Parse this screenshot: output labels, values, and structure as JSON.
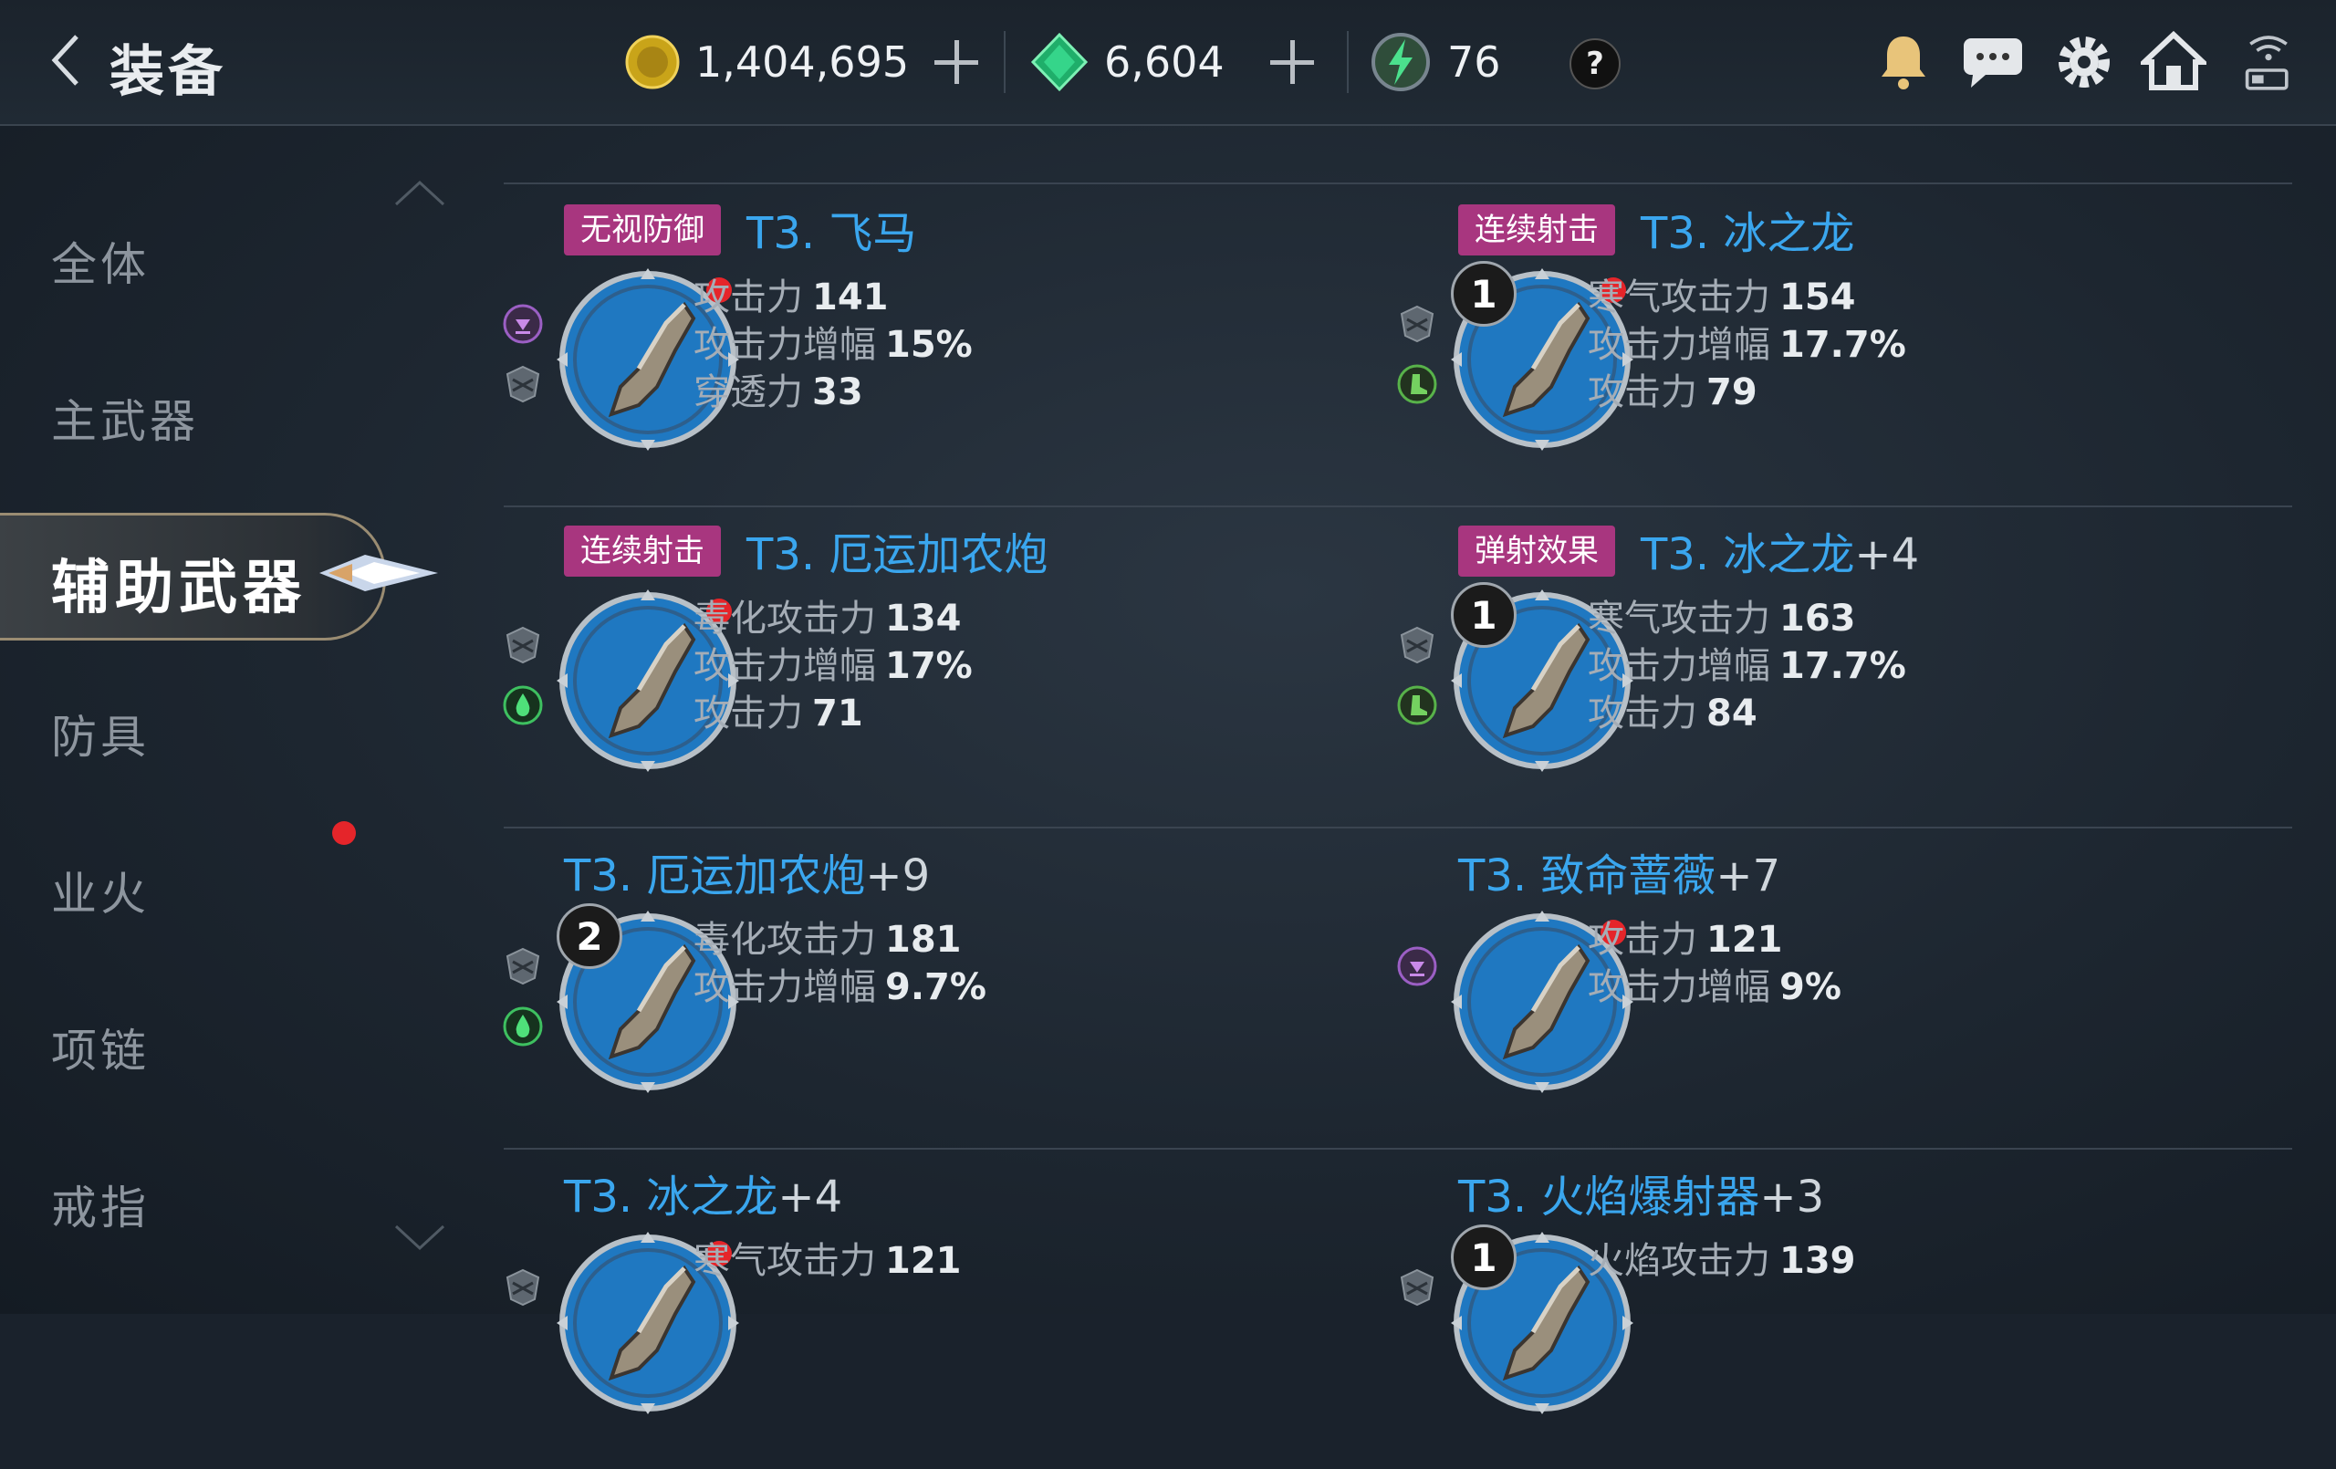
{
  "header": {
    "back_label": "back",
    "title": "装备",
    "gold": "1,404,695",
    "gems": "6,604",
    "energy": "76",
    "help": "?"
  },
  "sidebar": {
    "items": [
      {
        "label": "全体"
      },
      {
        "label": "主武器"
      },
      {
        "label": "辅助武器",
        "active": true
      },
      {
        "label": "防具"
      },
      {
        "label": "业火",
        "notify": true
      },
      {
        "label": "项链"
      },
      {
        "label": "戒指"
      }
    ]
  },
  "items": [
    {
      "tag": "无视防御",
      "name": "T3. 飞马",
      "level": "",
      "badge": "",
      "new": true,
      "stats": [
        {
          "label": "攻击力",
          "value": "141"
        },
        {
          "label": "攻击力增幅",
          "value": "15%"
        },
        {
          "label": "穿透力",
          "value": "33"
        }
      ],
      "icons": [
        "purple-down-icon",
        "shield-grey-icon"
      ],
      "accent": "#1f78c1"
    },
    {
      "tag": "连续射击",
      "name": "T3. 冰之龙",
      "level": "",
      "badge": "1",
      "new": true,
      "stats": [
        {
          "label": "寒气攻击力",
          "value": "154"
        },
        {
          "label": "攻击力增幅",
          "value": "17.7%"
        },
        {
          "label": "攻击力",
          "value": "79"
        }
      ],
      "icons": [
        "shield-grey-icon",
        "green-boot-icon"
      ],
      "accent": "#1f78c1"
    },
    {
      "tag": "连续射击",
      "name": "T3. 厄运加农炮",
      "level": "",
      "badge": "",
      "new": true,
      "stats": [
        {
          "label": "毒化攻击力",
          "value": "134"
        },
        {
          "label": "攻击力增幅",
          "value": "17%"
        },
        {
          "label": "攻击力",
          "value": "71"
        }
      ],
      "icons": [
        "shield-grey-icon",
        "green-drop-icon"
      ],
      "accent": "#1f78c1"
    },
    {
      "tag": "弹射效果",
      "name": "T3. 冰之龙",
      "level": "+4",
      "badge": "1",
      "new": false,
      "stats": [
        {
          "label": "寒气攻击力",
          "value": "163"
        },
        {
          "label": "攻击力增幅",
          "value": "17.7%"
        },
        {
          "label": "攻击力",
          "value": "84"
        }
      ],
      "icons": [
        "shield-grey-icon",
        "green-boot-icon"
      ],
      "accent": "#1f78c1"
    },
    {
      "tag": "",
      "name": "T3. 厄运加农炮",
      "level": "+9",
      "badge": "2",
      "new": false,
      "stats": [
        {
          "label": "毒化攻击力",
          "value": "181"
        },
        {
          "label": "攻击力增幅",
          "value": "9.7%"
        }
      ],
      "icons": [
        "shield-grey-icon",
        "green-drop-icon"
      ],
      "accent": "#1f78c1"
    },
    {
      "tag": "",
      "name": "T3. 致命蔷薇",
      "level": "+7",
      "badge": "",
      "new": true,
      "stats": [
        {
          "label": "攻击力",
          "value": "121"
        },
        {
          "label": "攻击力增幅",
          "value": "9%"
        }
      ],
      "icons": [
        "purple-down-icon"
      ],
      "accent": "#1f78c1"
    },
    {
      "tag": "",
      "name": "T3. 冰之龙",
      "level": "+4",
      "badge": "",
      "new": true,
      "stats": [
        {
          "label": "寒气攻击力",
          "value": "121"
        }
      ],
      "icons": [
        "shield-grey-icon"
      ],
      "accent": "#1f78c1"
    },
    {
      "tag": "",
      "name": "T3. 火焰爆射器",
      "level": "+3",
      "badge": "1",
      "new": false,
      "stats": [
        {
          "label": "火焰攻击力",
          "value": "139"
        }
      ],
      "icons": [
        "shield-grey-icon"
      ],
      "accent": "#1f78c1"
    }
  ]
}
